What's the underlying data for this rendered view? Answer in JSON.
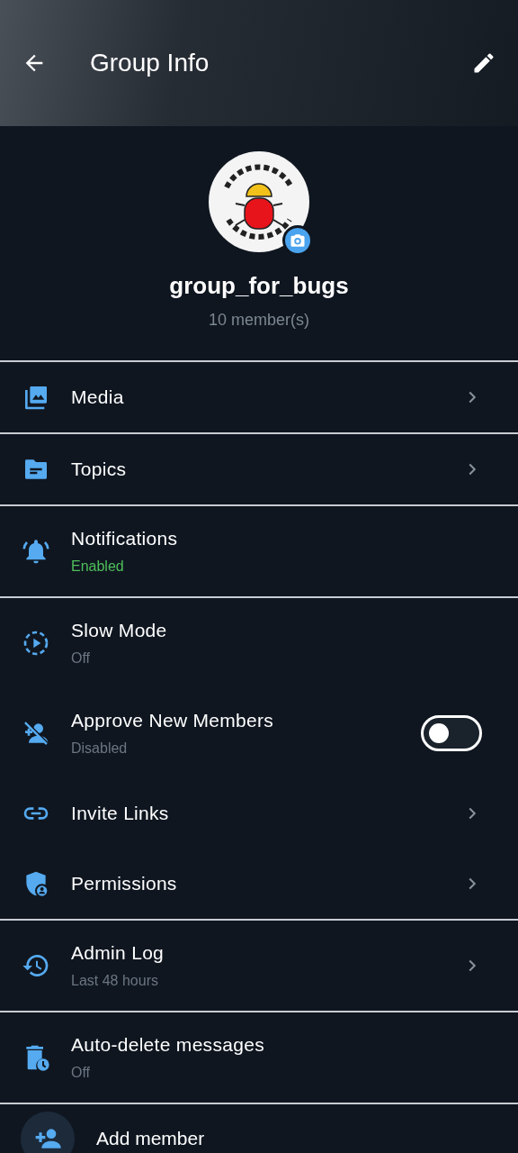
{
  "header": {
    "title": "Group Info"
  },
  "group": {
    "name": "group_for_bugs",
    "members": "10 member(s)"
  },
  "sections": [
    [
      {
        "kind": "nav",
        "title": "Media"
      }
    ],
    [
      {
        "kind": "nav",
        "title": "Topics"
      }
    ],
    [
      {
        "kind": "plain",
        "title": "Notifications",
        "subtitle": "Enabled",
        "subtitle_active": true
      }
    ],
    [
      {
        "kind": "plain",
        "title": "Slow Mode",
        "subtitle": "Off",
        "subtitle_active": false
      },
      {
        "kind": "toggle",
        "title": "Approve New Members",
        "subtitle": "Disabled",
        "subtitle_active": false,
        "on": false
      },
      {
        "kind": "nav",
        "title": "Invite Links"
      },
      {
        "kind": "nav",
        "title": "Permissions"
      }
    ],
    [
      {
        "kind": "nav",
        "title": "Admin Log",
        "subtitle": "Last 48 hours",
        "subtitle_active": false
      }
    ],
    [
      {
        "kind": "plain",
        "title": "Auto-delete messages",
        "subtitle": "Off",
        "subtitle_active": false
      }
    ]
  ],
  "add_member": {
    "label": "Add member"
  }
}
